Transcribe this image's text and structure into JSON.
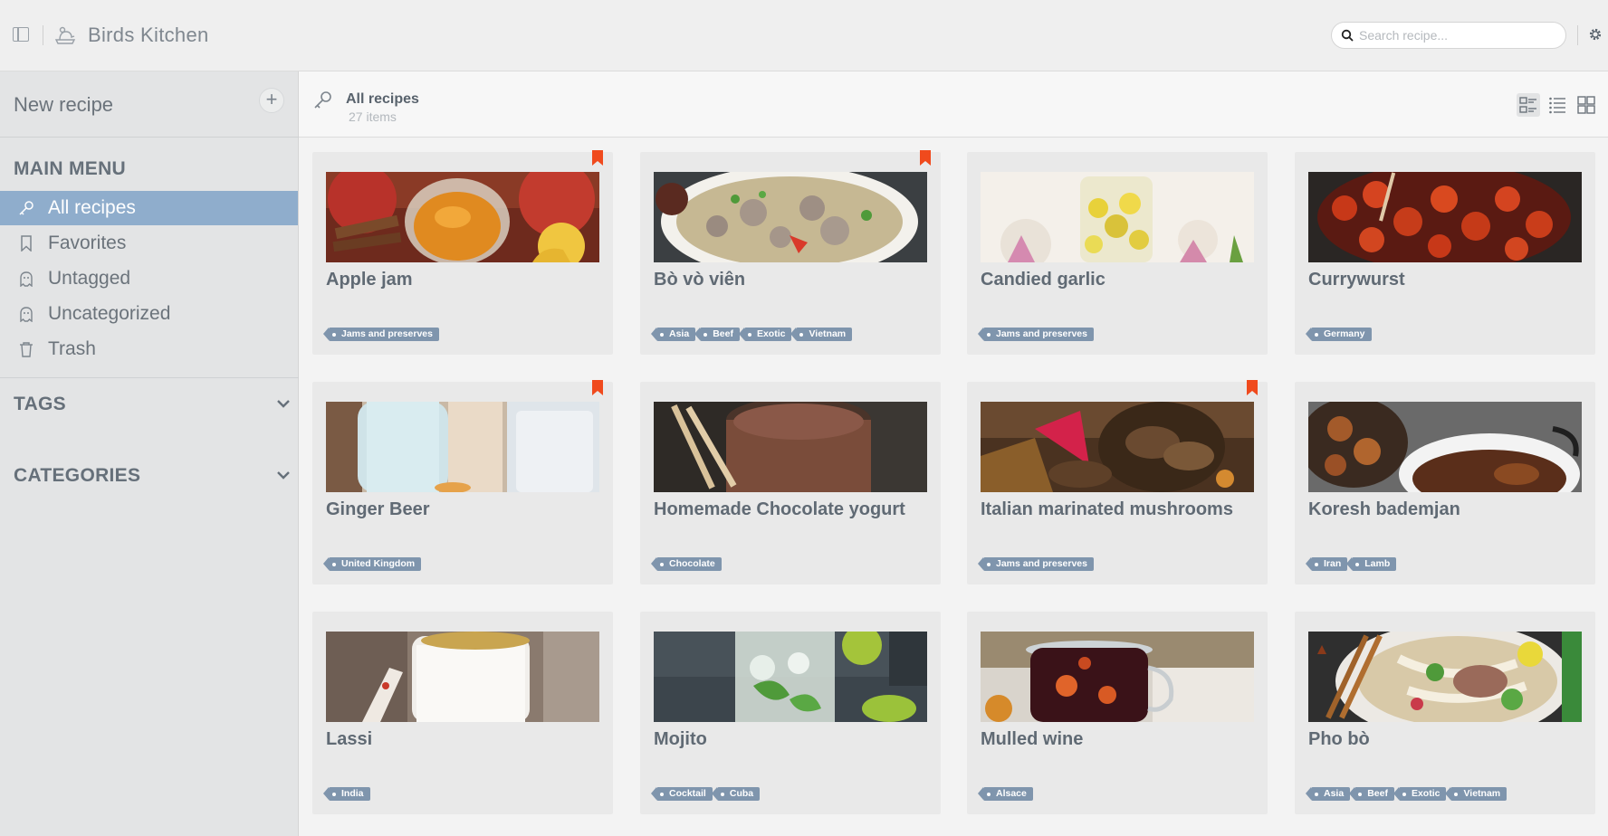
{
  "app": {
    "title": "Birds Kitchen",
    "search_placeholder": "Search recipe..."
  },
  "sidebar": {
    "new_recipe_label": "New recipe",
    "new_recipe_plus": "+",
    "main_menu_title": "MAIN MENU",
    "items": [
      {
        "label": "All recipes",
        "icon": "key-icon",
        "active": true
      },
      {
        "label": "Favorites",
        "icon": "bookmark-icon",
        "active": false
      },
      {
        "label": "Untagged",
        "icon": "ghost-icon",
        "active": false
      },
      {
        "label": "Uncategorized",
        "icon": "ghost-icon",
        "active": false
      },
      {
        "label": "Trash",
        "icon": "trash-icon",
        "active": false
      }
    ],
    "tags_title": "TAGS",
    "categories_title": "CATEGORIES"
  },
  "content": {
    "title": "All recipes",
    "count": "27 items",
    "views": [
      "card-list-view",
      "list-view",
      "grid-view"
    ]
  },
  "colors": {
    "accent": "#8fadcc",
    "tag": "#7f95ad",
    "bookmark": "#f04a1d"
  },
  "recipes": [
    {
      "title": "Apple jam",
      "tags": [
        "Jams and preserves"
      ],
      "favorite": true
    },
    {
      "title": "Bò vò viên",
      "tags": [
        "Asia",
        "Beef",
        "Exotic",
        "Vietnam"
      ],
      "favorite": true
    },
    {
      "title": "Candied garlic",
      "tags": [
        "Jams and preserves"
      ],
      "favorite": false
    },
    {
      "title": "Currywurst",
      "tags": [
        "Germany"
      ],
      "favorite": false
    },
    {
      "title": "Ginger Beer",
      "tags": [
        "United Kingdom"
      ],
      "favorite": true
    },
    {
      "title": "Homemade Chocolate yogurt",
      "tags": [
        "Chocolate"
      ],
      "favorite": false
    },
    {
      "title": "Italian marinated mushrooms",
      "tags": [
        "Jams and preserves"
      ],
      "favorite": true
    },
    {
      "title": "Koresh bademjan",
      "tags": [
        "Iran",
        "Lamb"
      ],
      "favorite": false
    },
    {
      "title": "Lassi",
      "tags": [
        "India"
      ],
      "favorite": false
    },
    {
      "title": "Mojito",
      "tags": [
        "Cocktail",
        "Cuba"
      ],
      "favorite": false
    },
    {
      "title": "Mulled wine",
      "tags": [
        "Alsace"
      ],
      "favorite": false
    },
    {
      "title": "Pho bò",
      "tags": [
        "Asia",
        "Beef",
        "Exotic",
        "Vietnam"
      ],
      "favorite": false
    }
  ]
}
